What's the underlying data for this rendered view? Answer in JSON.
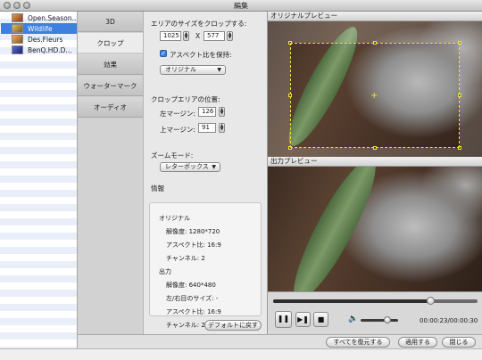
{
  "window": {
    "title": "編集"
  },
  "files": [
    {
      "name": "Open.Season...",
      "selected": false,
      "thumb": "#c46b2c"
    },
    {
      "name": "Wildlife",
      "selected": true,
      "thumb": "#c7a040"
    },
    {
      "name": "Des.Fleurs",
      "selected": false,
      "thumb": "#c98c3a"
    },
    {
      "name": "BenQ.HD.D...",
      "selected": false,
      "thumb": "#2a3f9e"
    }
  ],
  "tabs": [
    {
      "label": "3D",
      "active": false
    },
    {
      "label": "クロップ",
      "active": true
    },
    {
      "label": "効果",
      "active": false
    },
    {
      "label": "ウォーターマーク",
      "active": false
    },
    {
      "label": "オーディオ",
      "active": false
    }
  ],
  "crop": {
    "size_label": "エリアのサイズをクロップする:",
    "width": "1025",
    "x_sep": "X",
    "height": "577",
    "keep_aspect_label": "アスペクト比を保持:",
    "keep_aspect_checked": true,
    "aspect_value": "オリジナル",
    "position_label": "クロップエリアの位置:",
    "left_margin_label": "左マージン:",
    "left_margin": "126",
    "top_margin_label": "上マージン:",
    "top_margin": "91",
    "zoom_label": "ズームモード:",
    "zoom_value": "レターボックス"
  },
  "info": {
    "title": "情報",
    "original_heading": "オリジナル",
    "original_resolution": "解像度: 1280*720",
    "original_aspect": "アスペクト比: 16:9",
    "original_channels": "チャンネル: 2",
    "output_heading": "出力",
    "output_resolution": "解像度: 640*480",
    "output_lr_size": "左/右目のサイズ: -",
    "output_aspect": "アスペクト比: 16:9",
    "output_channels": "チャンネル: 2"
  },
  "buttons": {
    "reset_default": "デフォルトに戻す",
    "restore_all": "すべてを復元する",
    "apply": "適用する",
    "close": "閉じる"
  },
  "preview": {
    "original_label": "オリジナルプレビュー",
    "output_label": "出力プレビュー",
    "time": "00:00:23/00:00:30",
    "progress": 0.77,
    "volume": 0.72
  },
  "icons": {
    "pause": "pause-icon",
    "step": "step-forward-icon",
    "stop": "stop-icon",
    "volume": "speaker-icon",
    "caret": "chevron-down-icon"
  }
}
